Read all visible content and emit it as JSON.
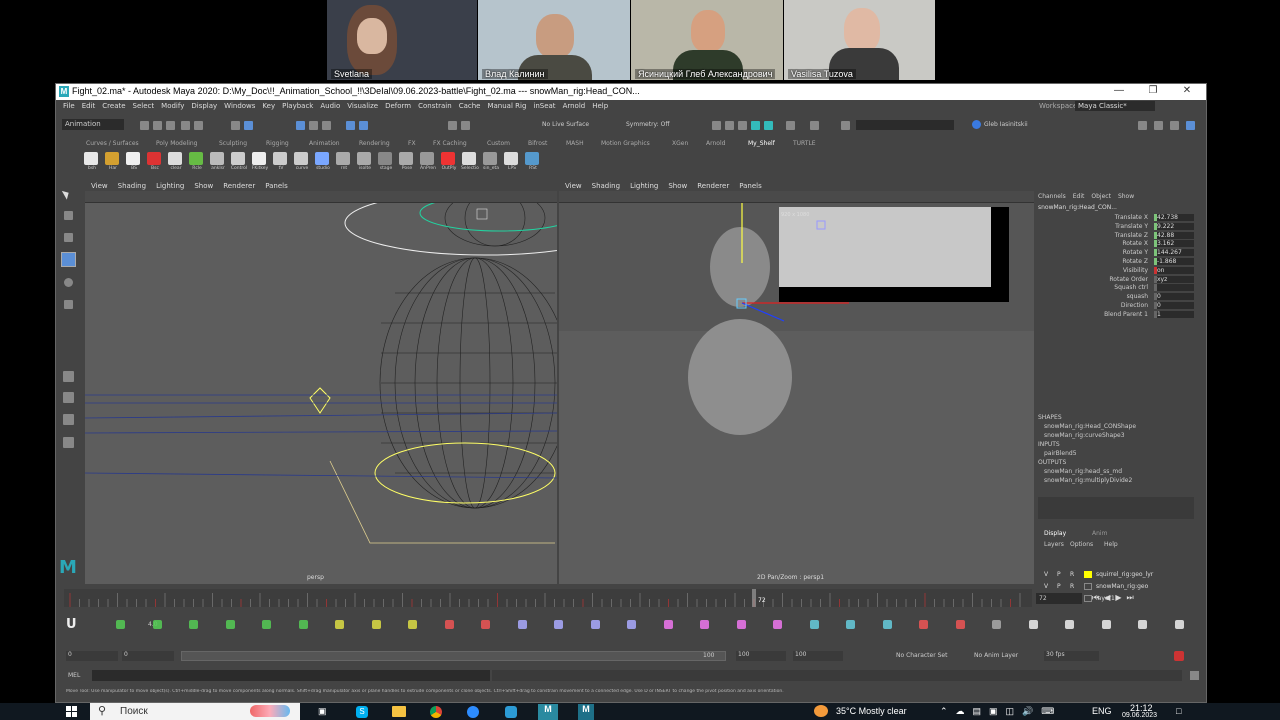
{
  "call": {
    "participants": [
      {
        "name": "Svetlana"
      },
      {
        "name": "Влад Калинин"
      },
      {
        "name": "Ясиницкий Глеб Александрович"
      },
      {
        "name": "Vasilisa Tuzova"
      }
    ]
  },
  "window": {
    "title": "Fight_02.ma* - Autodesk Maya 2020: D:\\My_Doc\\!!_Animation_School_!!\\3DeIal\\09.06.2023-battle\\Fight_02.ma   ---   snowMan_rig:Head_CON..."
  },
  "menubar": [
    "File",
    "Edit",
    "Create",
    "Select",
    "Modify",
    "Display",
    "Windows",
    "Key",
    "Playback",
    "Audio",
    "Visualize",
    "Deform",
    "Constrain",
    "Cache",
    "Manual Rig",
    "inSeat",
    "Arnold",
    "Help"
  ],
  "workspace": {
    "label": "Workspace :",
    "value": "Maya Classic*"
  },
  "statusline": {
    "mode": "Animation",
    "live_surface": "No Live Surface",
    "symmetry": "Symmetry: Off",
    "user": "Gleb Iasinitskii"
  },
  "shelf_tabs": [
    "Curves / Surfaces",
    "Poly Modeling",
    "Sculpting",
    "Rigging",
    "Animation",
    "Rendering",
    "FX",
    "FX Caching",
    "Custom",
    "Bifrost",
    "MASH",
    "Motion Graphics",
    "XGen",
    "Arnold",
    "My_Shelf",
    "TURTLE"
  ],
  "shelf_labels": [
    "bsh",
    "Har",
    "BS",
    "Bsc",
    "clear",
    "Rcle",
    "anklsr",
    "Control",
    "FKitkey",
    "tV",
    "curve",
    "studio",
    "rnt",
    "isolte",
    "stage",
    "Pose",
    "AnPren",
    "OutPly",
    "Selectio",
    "sin_eta",
    "LPS",
    "RSt"
  ],
  "panel_menu": [
    "View",
    "Shading",
    "Lighting",
    "Show",
    "Renderer",
    "Panels"
  ],
  "viewports": {
    "left_label": "persp",
    "right_label": "2D Pan/Zoom : persp1",
    "resolution": "920 x 1080"
  },
  "channel_box": {
    "tabs": [
      "Channels",
      "Edit",
      "Object",
      "Show"
    ],
    "object": "snowMan_rig:Head_CON...",
    "channels": [
      {
        "name": "Translate X",
        "value": "42.738"
      },
      {
        "name": "Translate Y",
        "value": "9.222"
      },
      {
        "name": "Translate Z",
        "value": "42.88"
      },
      {
        "name": "Rotate X",
        "value": "3.162"
      },
      {
        "name": "Rotate Y",
        "value": "144.267"
      },
      {
        "name": "Rotate Z",
        "value": "-1.868"
      },
      {
        "name": "Visibility",
        "value": "on"
      },
      {
        "name": "Rotate Order",
        "value": "xyz"
      },
      {
        "name": "Squash ctrl",
        "value": ""
      },
      {
        "name": "squash",
        "value": "0"
      },
      {
        "name": "Direction",
        "value": "0"
      },
      {
        "name": "Blend Parent 1",
        "value": "1"
      }
    ],
    "shapes_header": "SHAPES",
    "shapes": [
      "snowMan_rig:Head_CONShape",
      "snowMan_rig:curveShape3"
    ],
    "inputs_header": "INPUTS",
    "inputs": [
      "pairBlend5"
    ],
    "outputs_header": "OUTPUTS",
    "outputs": [
      "snowMan_rig:head_ss_md",
      "snowMan_rig:multiplyDivide2"
    ]
  },
  "layer_editor": {
    "tabs": [
      "Display",
      "Anim"
    ],
    "menu": [
      "Layers",
      "Options",
      "Help"
    ],
    "layers": [
      {
        "v": "V",
        "p": "P",
        "r": "R",
        "name": "squirrel_rig:geo_lyr",
        "color": "#ffff00"
      },
      {
        "v": "V",
        "p": "P",
        "r": "R",
        "name": "snowMan_rig:geo",
        "color": ""
      },
      {
        "v": "V",
        "p": "P",
        "r": "R",
        "name": "layer1",
        "color": ""
      }
    ]
  },
  "timeline": {
    "current_frame": "72",
    "frame_field": "72",
    "range_start": "0",
    "range_start2": "0",
    "range_mid": "100",
    "range_end": "100",
    "range_end2": "100",
    "fps": "30 fps",
    "character_set": "No Character Set",
    "anim_layer": "No Anim Layer",
    "mel_label": "MEL",
    "toolbar_value": "4.0"
  },
  "helpline": "Move Tool: Use manipulator to move object(s). Ctrl+middle-drag to move components along normals. Shift+drag manipulator axis or plane handles to extrude components or clone objects. Ctrl+Shift+drag to constrain movement to a connected edge. Use D or INSERT to change the pivot position and axis orientation.",
  "taskbar": {
    "search": "Поиск",
    "weather": "35°C  Mostly clear",
    "lang": "ENG",
    "time": "21:12",
    "date": "09.06.2023"
  },
  "colors": {
    "maya_bg": "#444444",
    "viewport": "#5d5d5d",
    "taskbar": "#101820",
    "accent": "#2aa8b8"
  }
}
